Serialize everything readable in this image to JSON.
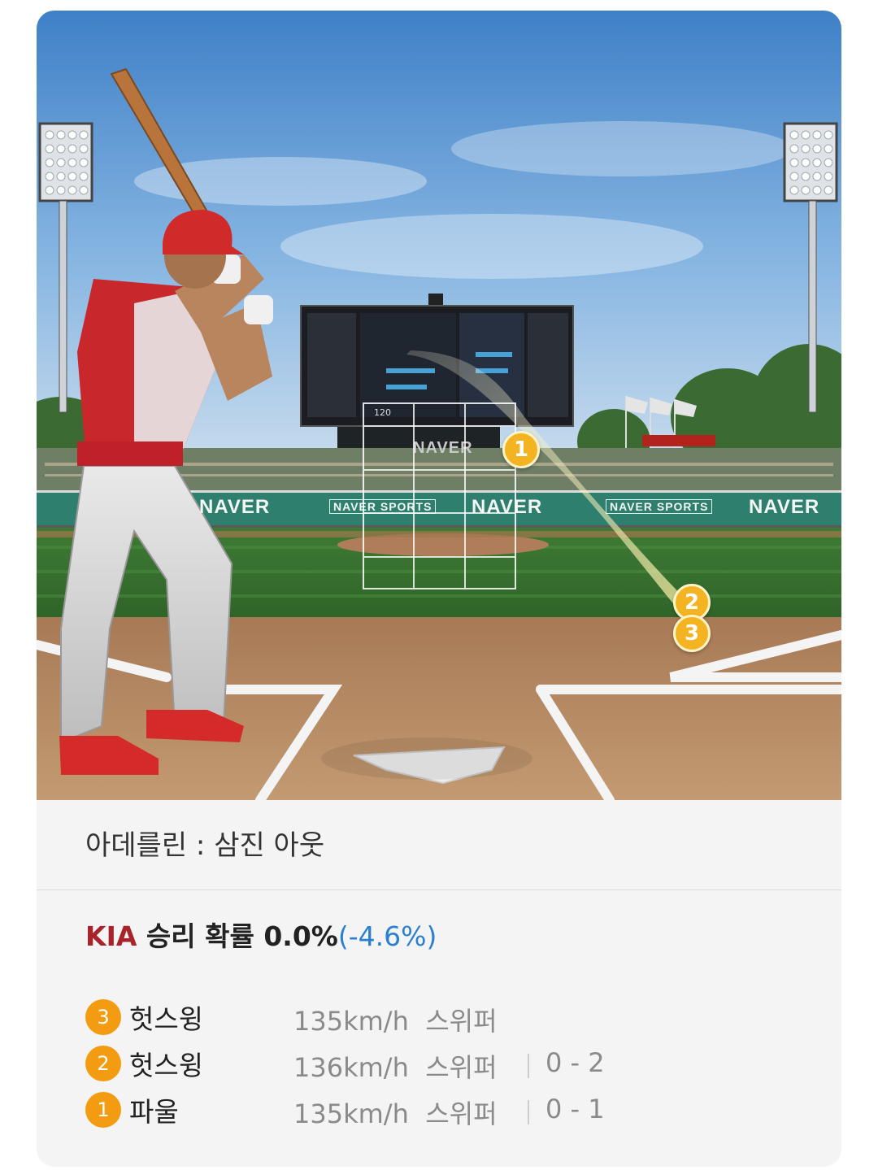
{
  "scene": {
    "ad_boards": [
      "NAVER",
      "NAVER SPORTS",
      "NAVER",
      "NAVER SPORTS",
      "NAVER"
    ],
    "backdrop_text": "NAVER",
    "zone_readout": "120",
    "trajectory_markers": [
      "1",
      "2",
      "3"
    ]
  },
  "caption": {
    "text": "아데를린 : 삼진 아웃"
  },
  "win_probability": {
    "team": "KIA",
    "label": "승리 확률",
    "value": "0.0%",
    "delta": "(-4.6%)"
  },
  "pitches": [
    {
      "number": "3",
      "result": "헛스윙",
      "speed": "135km/h",
      "pitch_type": "스위퍼",
      "count": ""
    },
    {
      "number": "2",
      "result": "헛스윙",
      "speed": "136km/h",
      "pitch_type": "스위퍼",
      "count": "0 - 2"
    },
    {
      "number": "1",
      "result": "파울",
      "speed": "135km/h",
      "pitch_type": "스위퍼",
      "count": "0 - 1"
    }
  ],
  "colors": {
    "team": "#a8232a",
    "delta": "#2a7fd1",
    "badge": "#f39c12",
    "marker": "#f4b321"
  }
}
